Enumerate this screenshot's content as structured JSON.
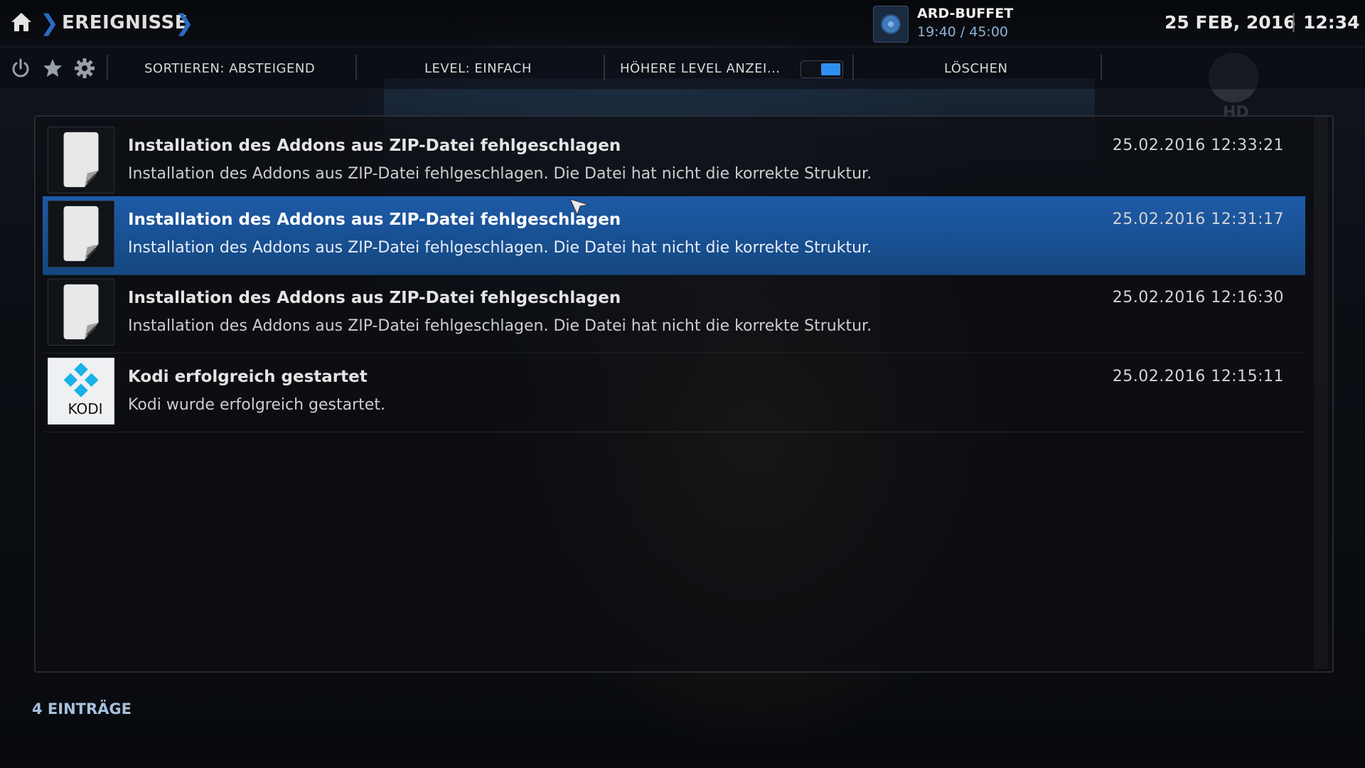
{
  "header": {
    "breadcrumb": "EREIGNISSE",
    "now_playing": {
      "title": "ARD-BUFFET",
      "time": "19:40 / 45:00"
    },
    "date": "25 FEB, 2016",
    "time": "12:34"
  },
  "toolbar": {
    "sort_label": "SORTIEREN: ABSTEIGEND",
    "level_label": "LEVEL: EINFACH",
    "higher_levels_label": "HÖHERE LEVEL ANZEI...",
    "higher_levels_enabled": true,
    "clear_label": "LÖSCHEN"
  },
  "events": [
    {
      "title": "Installation des Addons aus ZIP-Datei fehlgeschlagen",
      "description": "Installation des Addons aus ZIP-Datei fehlgeschlagen. Die Datei hat nicht die korrekte Struktur.",
      "datetime": "25.02.2016 12:33:21",
      "icon": "file-icon",
      "selected": false
    },
    {
      "title": "Installation des Addons aus ZIP-Datei fehlgeschlagen",
      "description": "Installation des Addons aus ZIP-Datei fehlgeschlagen. Die Datei hat nicht die korrekte Struktur.",
      "datetime": "25.02.2016 12:31:17",
      "icon": "file-icon",
      "selected": true
    },
    {
      "title": "Installation des Addons aus ZIP-Datei fehlgeschlagen",
      "description": "Installation des Addons aus ZIP-Datei fehlgeschlagen. Die Datei hat nicht die korrekte Struktur.",
      "datetime": "25.02.2016 12:16:30",
      "icon": "file-icon",
      "selected": false
    },
    {
      "title": "Kodi erfolgreich gestartet",
      "description": "Kodi wurde erfolgreich gestartet.",
      "datetime": "25.02.2016 12:15:11",
      "icon": "kodi-logo",
      "icon_text": "KODI",
      "selected": false
    }
  ],
  "footer": {
    "count": "4 EINTRÄGE"
  },
  "colors": {
    "accent": "#2a6bc2",
    "selection": "#1d5ba8",
    "toggle_on": "#2f8ff0"
  }
}
